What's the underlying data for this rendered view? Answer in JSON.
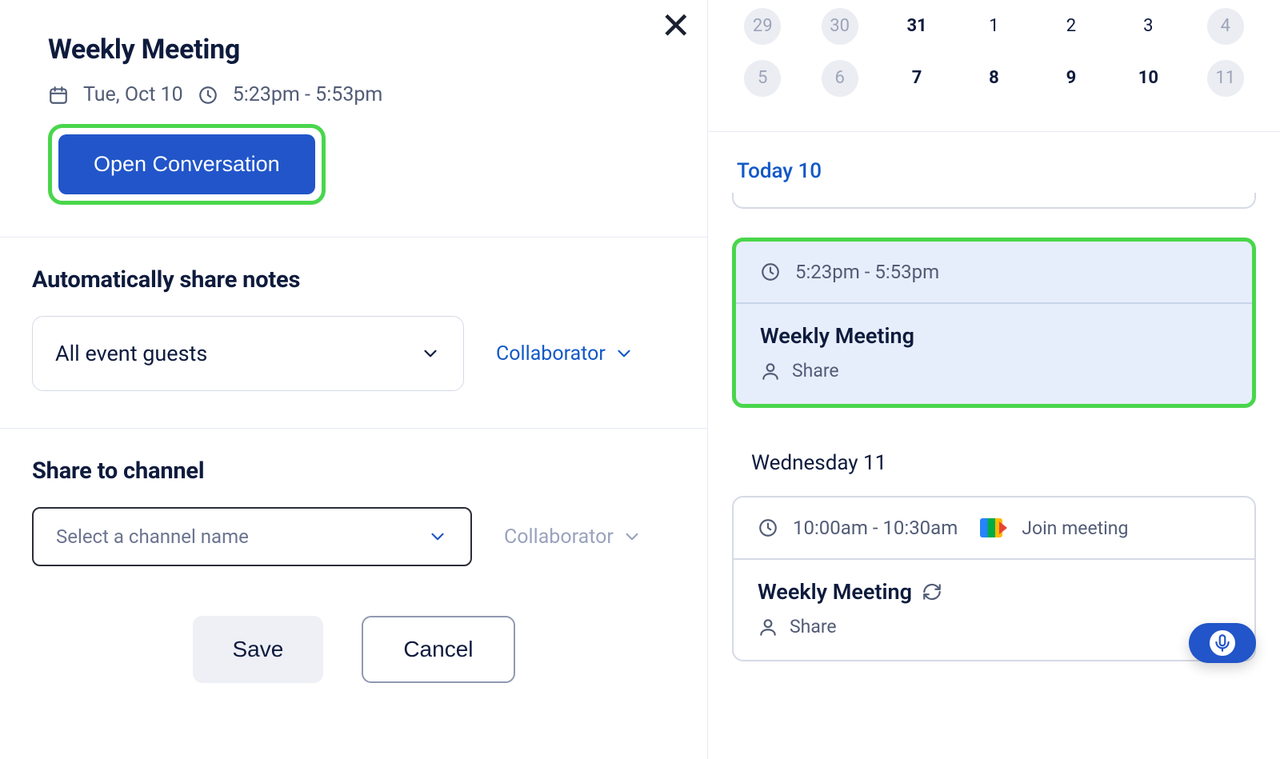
{
  "header": {
    "title": "Weekly Meeting",
    "date": "Tue, Oct 10",
    "time": "5:23pm - 5:53pm",
    "open_conversation": "Open Conversation"
  },
  "share_notes": {
    "heading": "Automatically share notes",
    "select_value": "All event guests",
    "role_label": "Collaborator"
  },
  "share_channel": {
    "heading": "Share to channel",
    "select_placeholder": "Select a channel name",
    "role_label": "Collaborator"
  },
  "actions": {
    "save": "Save",
    "cancel": "Cancel"
  },
  "calendar": {
    "row1": [
      "29",
      "30",
      "31",
      "1",
      "2",
      "3",
      "4"
    ],
    "row1_dim": [
      true,
      true,
      false,
      false,
      false,
      false,
      true
    ],
    "row1_chip": [
      true,
      true,
      false,
      false,
      false,
      false,
      true
    ],
    "row2": [
      "5",
      "6",
      "7",
      "8",
      "9",
      "10",
      "11"
    ],
    "row2_dim": [
      false,
      false,
      false,
      false,
      false,
      false,
      true
    ],
    "row2_chip": [
      true,
      true,
      false,
      false,
      false,
      false,
      true
    ],
    "today_label": "Today 10"
  },
  "agenda": {
    "event1": {
      "time": "5:23pm - 5:53pm",
      "title": "Weekly Meeting",
      "share": "Share"
    },
    "day2_label": "Wednesday 11",
    "event2": {
      "time": "10:00am - 10:30am",
      "join": "Join meeting",
      "title": "Weekly Meeting",
      "share": "Share"
    }
  }
}
